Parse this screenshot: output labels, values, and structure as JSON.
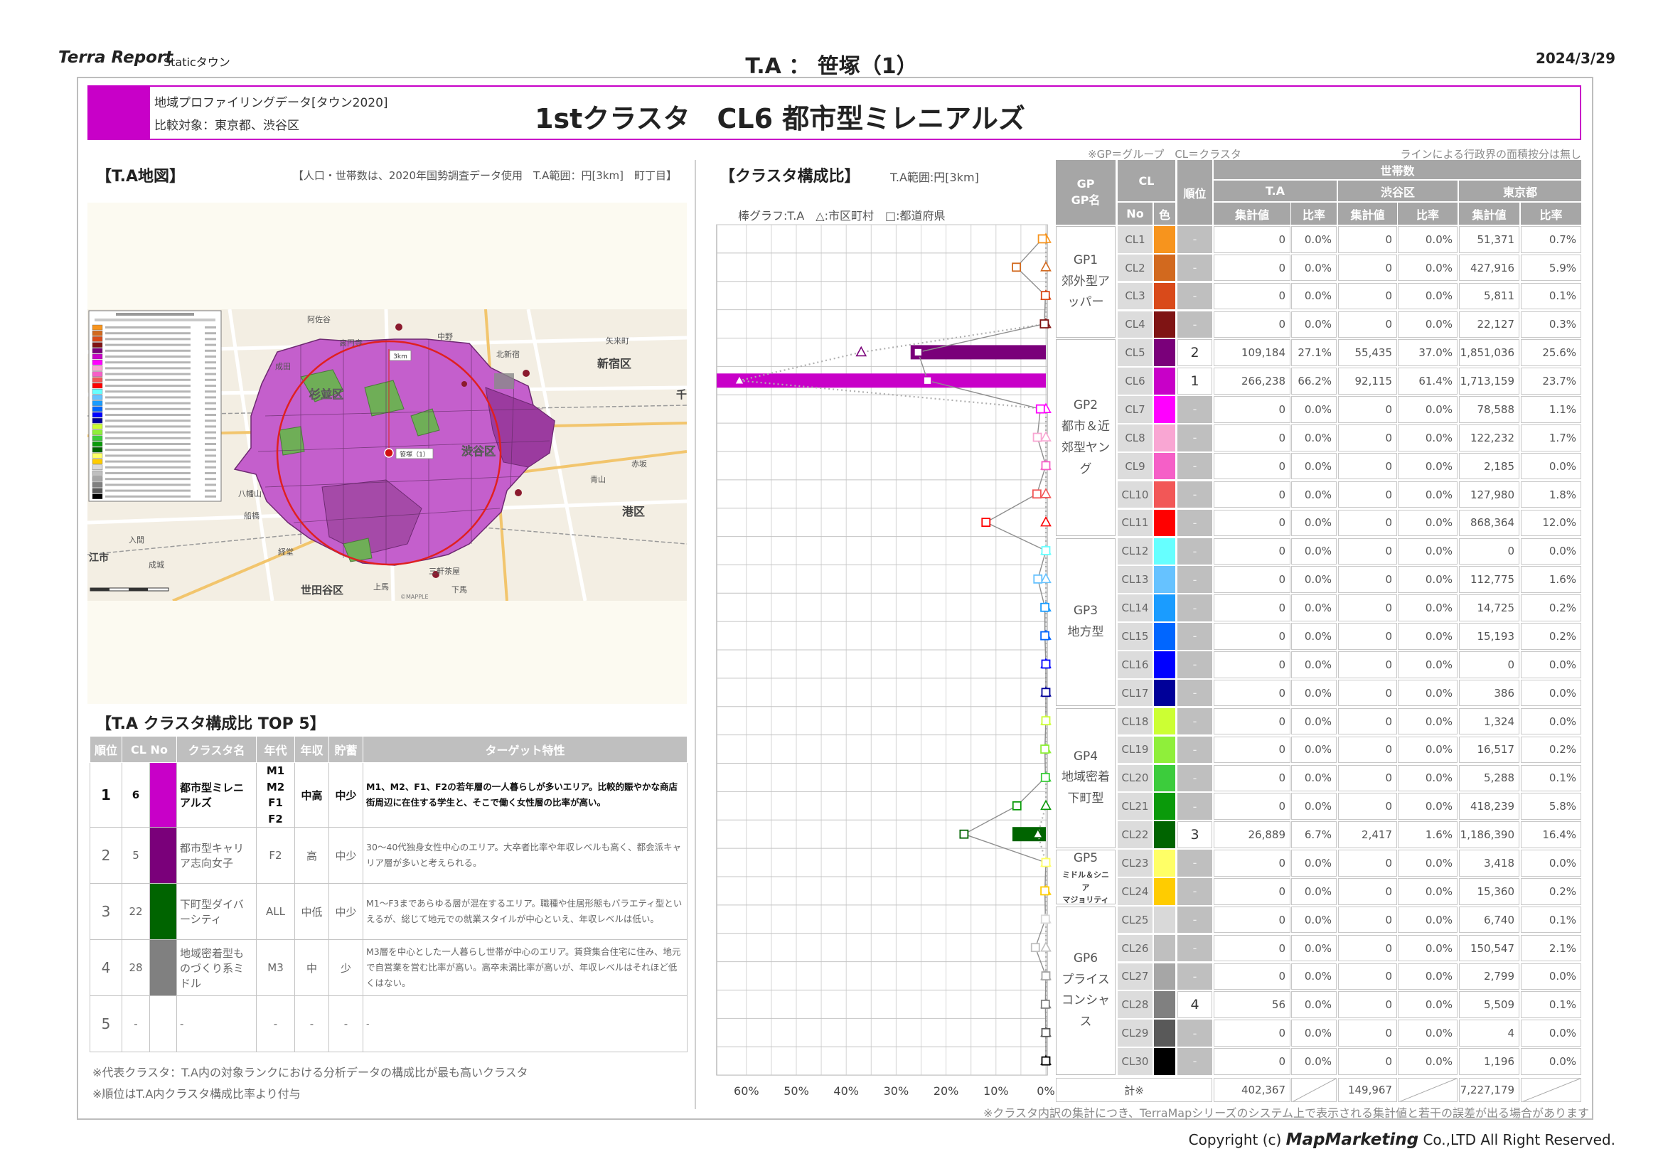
{
  "header": {
    "brand": "Terra Report",
    "product": "Staticタウン",
    "title": "T.A ： 笹塚（1）",
    "date": "2024/3/29"
  },
  "titlebar": {
    "line1": "地域プロファイリングデータ[タウン2020]",
    "line2": "比較対象：東京都、渋谷区",
    "main": "1stクラスタ　CL6 都市型ミレニアルズ",
    "accent": "#c800c8"
  },
  "map": {
    "title": "【T.A地図】",
    "note": "【人口・世帯数は、2020年国勢調査データ使用　T.A範囲：円[3km]　町丁目】",
    "labels": {
      "asagaya": "阿佐谷",
      "koenji": "高円寺",
      "nakano": "中野",
      "kitashinjuku": "北新宿",
      "yaraicho": "矢来町",
      "shinjuku": "新宿区",
      "suginami": "杉並区",
      "narita": "成田",
      "shibuya": "渋谷区",
      "akasaka": "赤坂",
      "aoyama": "青山",
      "minato": "港区",
      "hachimanyama": "八幡山",
      "funabashi": "船橋",
      "kyodo": "経堂",
      "seijo": "成城",
      "iruma": "入間",
      "eshi": "江市",
      "setagaya": "世田谷区",
      "kamiuma": "上馬",
      "sangenjaya": "三軒茶屋",
      "shimouma": "下馬",
      "sen": "千",
      "radius": "3km",
      "site": "笹塚（1）",
      "credit": "©MAPPLE"
    }
  },
  "top5": {
    "title": "【T.A クラスタ構成比 TOP 5】",
    "headers": [
      "順位",
      "CL No",
      "クラスタ名",
      "年代",
      "年収",
      "貯蓄",
      "ターゲット特性"
    ],
    "rows": [
      {
        "rank": "1",
        "cl": "6",
        "color": "#c800c8",
        "name": "都市型ミレニアルズ",
        "age": "M1 M2 F1 F2",
        "income": "中高",
        "savings": "中少",
        "target": "M1、M2、F1、F2の若年層の一人暮らしが多いエリア。比較的賑やかな商店街周辺に在住する学生と、そこで働く女性層の比率が高い。"
      },
      {
        "rank": "2",
        "cl": "5",
        "color": "#7a007a",
        "name": "都市型キャリア志向女子",
        "age": "F2",
        "income": "高",
        "savings": "中少",
        "target": "30～40代独身女性中心のエリア。大卒者比率や年収レベルも高く、都会派キャリア層が多いと考えられる。"
      },
      {
        "rank": "3",
        "cl": "22",
        "color": "#006400",
        "name": "下町型ダイバーシティ",
        "age": "ALL",
        "income": "中低",
        "savings": "中少",
        "target": "M1～F3まであらゆる層が混在するエリア。職種や住居形態もバラエティ型といえるが、総じて地元での就業スタイルが中心といえ、年収レベルは低い。"
      },
      {
        "rank": "4",
        "cl": "28",
        "color": "#808080",
        "name": "地域密着型ものづくり系ミドル",
        "age": "M3",
        "income": "中",
        "savings": "少",
        "target": "M3層を中心とした一人暮らし世帯が中心のエリア。賃貸集合住宅に住み、地元で自営業を営む比率が高い。高卒未満比率が高いが、年収レベルはそれほど低くはない。"
      },
      {
        "rank": "5",
        "cl": "-",
        "color": "#ffffff",
        "name": "-",
        "age": "-",
        "income": "-",
        "savings": "-",
        "target": "-"
      }
    ]
  },
  "footnotes": [
    "※代表クラスタ：T.A内の対象ランクにおける分析データの構成比が最も高いクラスタ",
    "※順位はT.A内クラスタ構成比率より付与"
  ],
  "chart": {
    "title": "【クラスタ構成比】",
    "range": "T.A範囲:円[3km]",
    "legend": "棒グラフ:T.A　△:市区町村　□:都道府県"
  },
  "chart_data": {
    "type": "bar",
    "orientation": "horizontal",
    "categories": [
      "CL1",
      "CL2",
      "CL3",
      "CL4",
      "CL5",
      "CL6",
      "CL7",
      "CL8",
      "CL9",
      "CL10",
      "CL11",
      "CL12",
      "CL13",
      "CL14",
      "CL15",
      "CL16",
      "CL17",
      "CL18",
      "CL19",
      "CL20",
      "CL21",
      "CL22",
      "CL23",
      "CL24",
      "CL25",
      "CL26",
      "CL27",
      "CL28",
      "CL29",
      "CL30"
    ],
    "series": [
      {
        "name": "T.A",
        "marker": "bar",
        "values": [
          0,
          0,
          0,
          0,
          27.1,
          66.2,
          0,
          0,
          0,
          0,
          0,
          0,
          0,
          0,
          0,
          0,
          0,
          0,
          0,
          0,
          0,
          6.7,
          0,
          0,
          0,
          0,
          0,
          0,
          0,
          0
        ]
      },
      {
        "name": "市区町村",
        "marker": "triangle",
        "values": [
          0,
          0,
          0,
          0,
          37.0,
          61.4,
          0,
          0,
          0,
          0,
          0,
          0,
          0,
          0,
          0,
          0,
          0,
          0,
          0,
          0,
          0,
          1.6,
          0,
          0,
          0,
          0,
          0,
          0,
          0,
          0
        ]
      },
      {
        "name": "都道府県",
        "marker": "square",
        "values": [
          0.7,
          5.9,
          0.1,
          0.3,
          25.6,
          23.7,
          1.1,
          1.7,
          0.0,
          1.8,
          12.0,
          0.0,
          1.6,
          0.2,
          0.2,
          0.0,
          0.0,
          0.0,
          0.2,
          0.1,
          5.8,
          16.4,
          0.0,
          0.2,
          0.1,
          2.1,
          0.0,
          0.1,
          0.0,
          0.0
        ]
      }
    ],
    "colors": [
      "#f7941d",
      "#d2691e",
      "#d94a1a",
      "#7f1414",
      "#7a007a",
      "#c800c8",
      "#ff00ff",
      "#f9a6d3",
      "#f55fc7",
      "#f25757",
      "#ff0000",
      "#66ffff",
      "#66c2ff",
      "#1a9cff",
      "#0066ff",
      "#0000ff",
      "#000099",
      "#ccff33",
      "#8fef3a",
      "#3ccc3c",
      "#0a9a0a",
      "#006400",
      "#ffff66",
      "#ffcc00",
      "#d9d9d9",
      "#bfbfbf",
      "#a6a6a6",
      "#808080",
      "#595959",
      "#000000"
    ],
    "x_ticks": [
      "60%",
      "50%",
      "40%",
      "30%",
      "20%",
      "10%",
      "0%"
    ],
    "xlim": [
      60,
      0
    ],
    "grid": true
  },
  "table": {
    "note_left": "※GP＝グループ　CL＝クラスタ",
    "note_right": "ラインによる行政界の面積按分は無し",
    "headers": {
      "gp": "GP",
      "gp_name": "GP名",
      "cl": "CL",
      "no": "No",
      "color": "色",
      "rank": "順位",
      "households": "世帯数",
      "ta": "T.A",
      "city": "渋谷区",
      "pref": "東京都",
      "count": "集計値",
      "ratio": "比率"
    },
    "groups": [
      {
        "gp": "GP1",
        "name": "郊外型アッパー",
        "from": 0,
        "to": 3,
        "small": false
      },
      {
        "gp": "GP2",
        "name": "都市＆近郊型ヤング",
        "from": 4,
        "to": 10,
        "small": false
      },
      {
        "gp": "GP3",
        "name": "地方型",
        "from": 11,
        "to": 16,
        "small": false
      },
      {
        "gp": "GP4",
        "name": "地域密着下町型",
        "from": 17,
        "to": 21,
        "small": false
      },
      {
        "gp": "GP5",
        "name": "ミドル＆シニア マジョリティ",
        "from": 22,
        "to": 23,
        "small": true
      },
      {
        "gp": "GP6",
        "name": "プライスコンシャス",
        "from": 24,
        "to": 29,
        "small": false
      }
    ],
    "rows": [
      [
        "CL1",
        "-",
        "0",
        "0.0%",
        "0",
        "0.0%",
        "51,371",
        "0.7%"
      ],
      [
        "CL2",
        "-",
        "0",
        "0.0%",
        "0",
        "0.0%",
        "427,916",
        "5.9%"
      ],
      [
        "CL3",
        "-",
        "0",
        "0.0%",
        "0",
        "0.0%",
        "5,811",
        "0.1%"
      ],
      [
        "CL4",
        "-",
        "0",
        "0.0%",
        "0",
        "0.0%",
        "22,127",
        "0.3%"
      ],
      [
        "CL5",
        "2",
        "109,184",
        "27.1%",
        "55,435",
        "37.0%",
        "1,851,036",
        "25.6%"
      ],
      [
        "CL6",
        "1",
        "266,238",
        "66.2%",
        "92,115",
        "61.4%",
        "1,713,159",
        "23.7%"
      ],
      [
        "CL7",
        "-",
        "0",
        "0.0%",
        "0",
        "0.0%",
        "78,588",
        "1.1%"
      ],
      [
        "CL8",
        "-",
        "0",
        "0.0%",
        "0",
        "0.0%",
        "122,232",
        "1.7%"
      ],
      [
        "CL9",
        "-",
        "0",
        "0.0%",
        "0",
        "0.0%",
        "2,185",
        "0.0%"
      ],
      [
        "CL10",
        "-",
        "0",
        "0.0%",
        "0",
        "0.0%",
        "127,980",
        "1.8%"
      ],
      [
        "CL11",
        "-",
        "0",
        "0.0%",
        "0",
        "0.0%",
        "868,364",
        "12.0%"
      ],
      [
        "CL12",
        "-",
        "0",
        "0.0%",
        "0",
        "0.0%",
        "0",
        "0.0%"
      ],
      [
        "CL13",
        "-",
        "0",
        "0.0%",
        "0",
        "0.0%",
        "112,775",
        "1.6%"
      ],
      [
        "CL14",
        "-",
        "0",
        "0.0%",
        "0",
        "0.0%",
        "14,725",
        "0.2%"
      ],
      [
        "CL15",
        "-",
        "0",
        "0.0%",
        "0",
        "0.0%",
        "15,193",
        "0.2%"
      ],
      [
        "CL16",
        "-",
        "0",
        "0.0%",
        "0",
        "0.0%",
        "0",
        "0.0%"
      ],
      [
        "CL17",
        "-",
        "0",
        "0.0%",
        "0",
        "0.0%",
        "386",
        "0.0%"
      ],
      [
        "CL18",
        "-",
        "0",
        "0.0%",
        "0",
        "0.0%",
        "1,324",
        "0.0%"
      ],
      [
        "CL19",
        "-",
        "0",
        "0.0%",
        "0",
        "0.0%",
        "16,517",
        "0.2%"
      ],
      [
        "CL20",
        "-",
        "0",
        "0.0%",
        "0",
        "0.0%",
        "5,288",
        "0.1%"
      ],
      [
        "CL21",
        "-",
        "0",
        "0.0%",
        "0",
        "0.0%",
        "418,239",
        "5.8%"
      ],
      [
        "CL22",
        "3",
        "26,889",
        "6.7%",
        "2,417",
        "1.6%",
        "1,186,390",
        "16.4%"
      ],
      [
        "CL23",
        "-",
        "0",
        "0.0%",
        "0",
        "0.0%",
        "3,418",
        "0.0%"
      ],
      [
        "CL24",
        "-",
        "0",
        "0.0%",
        "0",
        "0.0%",
        "15,360",
        "0.2%"
      ],
      [
        "CL25",
        "-",
        "0",
        "0.0%",
        "0",
        "0.0%",
        "6,740",
        "0.1%"
      ],
      [
        "CL26",
        "-",
        "0",
        "0.0%",
        "0",
        "0.0%",
        "150,547",
        "2.1%"
      ],
      [
        "CL27",
        "-",
        "0",
        "0.0%",
        "0",
        "0.0%",
        "2,799",
        "0.0%"
      ],
      [
        "CL28",
        "4",
        "56",
        "0.0%",
        "0",
        "0.0%",
        "5,509",
        "0.1%"
      ],
      [
        "CL29",
        "-",
        "0",
        "0.0%",
        "0",
        "0.0%",
        "4",
        "0.0%"
      ],
      [
        "CL30",
        "-",
        "0",
        "0.0%",
        "0",
        "0.0%",
        "1,196",
        "0.0%"
      ]
    ],
    "total": {
      "label": "計※",
      "ta": "402,367",
      "city": "149,967",
      "pref": "7,227,179"
    }
  },
  "bottom_note": "※クラスタ内訳の集計につき、TerraMapシリーズのシステム上で表示される集計値と若干の誤差が出る場合があります",
  "copyright": {
    "prefix": "Copyright (c) ",
    "brand": "MapMarketing",
    "suffix": " Co.,LTD All Right Reserved."
  }
}
